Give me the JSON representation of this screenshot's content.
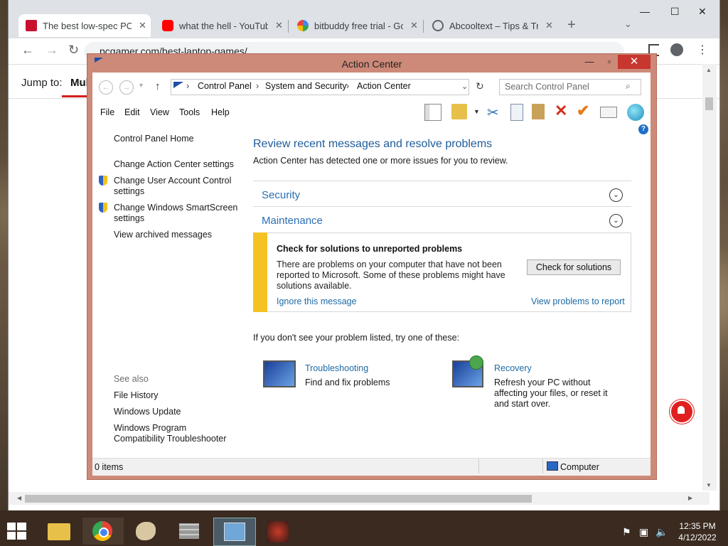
{
  "browser": {
    "tabs": [
      {
        "title": "The best low-spec PC g",
        "favicon": "pcgamer-icon",
        "active": true
      },
      {
        "title": "what the hell - YouTube",
        "favicon": "youtube-icon",
        "active": false
      },
      {
        "title": "bitbuddy free trial - Goo",
        "favicon": "google-icon",
        "active": false
      },
      {
        "title": "Abcooltext – Tips & Tric",
        "favicon": "globe-icon",
        "active": false
      }
    ],
    "url": "pcgamer.com/best-laptop-games/",
    "page": {
      "jump_label": "Jump to:",
      "jump_item": "Mul"
    }
  },
  "window": {
    "title": "Action Center",
    "breadcrumb": [
      "Control Panel",
      "System and Security",
      "Action Center"
    ],
    "search_placeholder": "Search Control Panel",
    "menu": [
      "File",
      "Edit",
      "View",
      "Tools",
      "Help"
    ],
    "sidebar": {
      "home": "Control Panel Home",
      "links": [
        {
          "label": "Change Action Center settings",
          "shield": false
        },
        {
          "label": "Change User Account Control settings",
          "shield": true
        },
        {
          "label": "Change Windows SmartScreen settings",
          "shield": true
        },
        {
          "label": "View archived messages",
          "shield": false
        }
      ],
      "see_also_label": "See also",
      "see_also": [
        "File History",
        "Windows Update",
        "Windows Program Compatibility Troubleshooter"
      ]
    },
    "main": {
      "heading": "Review recent messages and resolve problems",
      "subheading": "Action Center has detected one or more issues for you to review.",
      "sections": [
        "Security",
        "Maintenance"
      ],
      "message": {
        "title": "Check for solutions to unreported problems",
        "text": "There are problems on your computer that have not been reported to Microsoft. Some of these problems might have solutions available.",
        "button": "Check for solutions",
        "ignore_link": "Ignore this message",
        "view_link": "View problems to report",
        "accent_color": "#f5c223"
      },
      "try_text": "If you don't see your problem listed, try one of these:",
      "tools": [
        {
          "title": "Troubleshooting",
          "desc": "Find and fix problems"
        },
        {
          "title": "Recovery",
          "desc": "Refresh your PC without affecting your files, or reset it and start over."
        }
      ]
    },
    "status": {
      "items": "0 items",
      "location": "Computer"
    }
  },
  "taskbar": {
    "time": "12:35 PM",
    "date": "4/12/2022"
  }
}
